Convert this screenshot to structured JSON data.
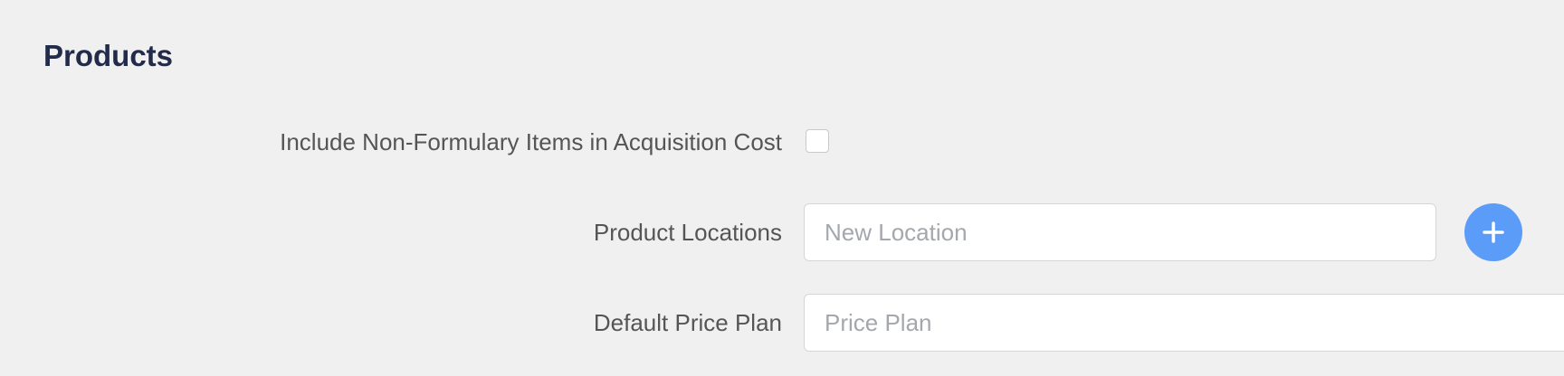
{
  "section": {
    "title": "Products"
  },
  "fields": {
    "include_non_formulary": {
      "label": "Include Non-Formulary Items in Acquisition Cost",
      "checked": false
    },
    "product_locations": {
      "label": "Product Locations",
      "value": "",
      "placeholder": "New Location",
      "add_icon": "plus-icon"
    },
    "default_price_plan": {
      "label": "Default Price Plan",
      "value": "",
      "placeholder": "Price Plan"
    }
  },
  "colors": {
    "background": "#f0f0f0",
    "title": "#232b4a",
    "label": "#555555",
    "placeholder": "#a4a8ad",
    "accent": "#5b9cf8"
  }
}
